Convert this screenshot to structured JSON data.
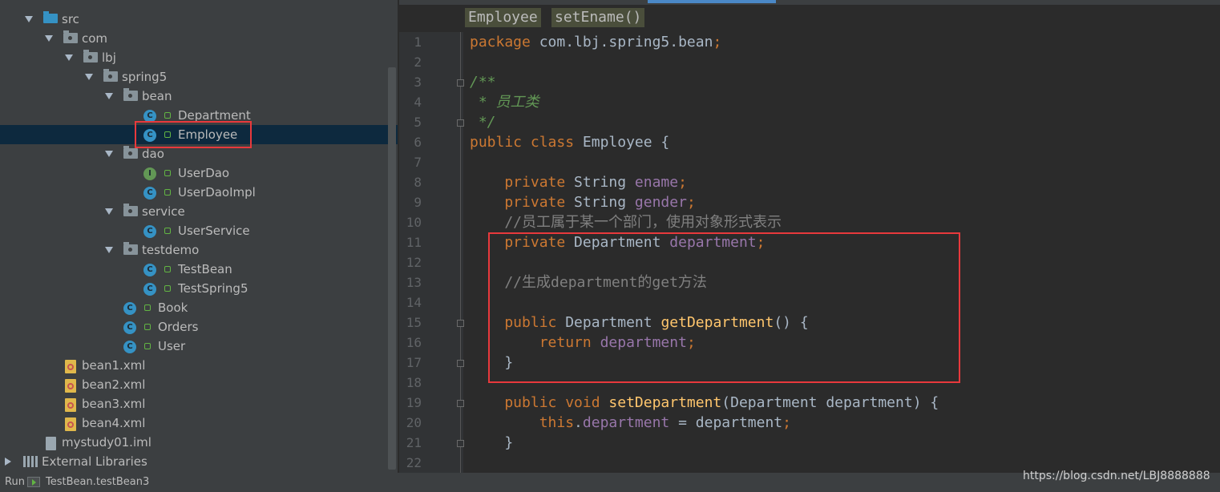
{
  "project_tree": {
    "items": [
      {
        "label": "src",
        "icon": "source-folder-icon"
      },
      {
        "label": "com",
        "icon": "package-icon"
      },
      {
        "label": "lbj",
        "icon": "package-icon"
      },
      {
        "label": "spring5",
        "icon": "package-icon"
      },
      {
        "label": "bean",
        "icon": "package-icon"
      },
      {
        "label": "Department",
        "icon": "class-icon"
      },
      {
        "label": "Employee",
        "icon": "class-icon"
      },
      {
        "label": "dao",
        "icon": "package-icon"
      },
      {
        "label": "UserDao",
        "icon": "interface-icon"
      },
      {
        "label": "UserDaoImpl",
        "icon": "class-icon"
      },
      {
        "label": "service",
        "icon": "package-icon"
      },
      {
        "label": "UserService",
        "icon": "class-icon"
      },
      {
        "label": "testdemo",
        "icon": "package-icon"
      },
      {
        "label": "TestBean",
        "icon": "class-icon"
      },
      {
        "label": "TestSpring5",
        "icon": "class-icon"
      },
      {
        "label": "Book",
        "icon": "class-icon"
      },
      {
        "label": "Orders",
        "icon": "class-icon"
      },
      {
        "label": "User",
        "icon": "class-icon"
      },
      {
        "label": "bean1.xml",
        "icon": "xml-file-icon"
      },
      {
        "label": "bean2.xml",
        "icon": "xml-file-icon"
      },
      {
        "label": "bean3.xml",
        "icon": "xml-file-icon"
      },
      {
        "label": "bean4.xml",
        "icon": "xml-file-icon"
      },
      {
        "label": "mystudy01.iml",
        "icon": "module-file-icon"
      },
      {
        "label": "External Libraries",
        "icon": "libraries-icon"
      }
    ],
    "selected": "Employee"
  },
  "editor": {
    "breadcrumbs": [
      "Employee",
      "setEname()"
    ],
    "lines": [
      {
        "n": "1",
        "p": [
          [
            "k",
            "package "
          ],
          [
            "t",
            "com.lbj.spring5.bean"
          ],
          [
            "k",
            ";"
          ]
        ]
      },
      {
        "n": "2",
        "p": []
      },
      {
        "n": "3",
        "p": [
          [
            "dc",
            "/**"
          ]
        ]
      },
      {
        "n": "4",
        "p": [
          [
            "dc",
            " * 员工类"
          ]
        ]
      },
      {
        "n": "5",
        "p": [
          [
            "dc",
            " */"
          ]
        ]
      },
      {
        "n": "6",
        "p": [
          [
            "k",
            "public class "
          ],
          [
            "t",
            "Employee {"
          ]
        ]
      },
      {
        "n": "7",
        "p": []
      },
      {
        "n": "8",
        "p": [
          [
            "k",
            "    private "
          ],
          [
            "t",
            "String "
          ],
          [
            "f",
            "ename"
          ],
          [
            "k",
            ";"
          ]
        ]
      },
      {
        "n": "9",
        "p": [
          [
            "k",
            "    private "
          ],
          [
            "t",
            "String "
          ],
          [
            "f",
            "gender"
          ],
          [
            "k",
            ";"
          ]
        ]
      },
      {
        "n": "10",
        "p": [
          [
            "c",
            "    //员工属于某一个部门，使用对象形式表示"
          ]
        ]
      },
      {
        "n": "11",
        "p": [
          [
            "k",
            "    private "
          ],
          [
            "t",
            "Department "
          ],
          [
            "f",
            "department"
          ],
          [
            "k",
            ";"
          ]
        ]
      },
      {
        "n": "12",
        "p": []
      },
      {
        "n": "13",
        "p": [
          [
            "c",
            "    //生成department的get方法"
          ]
        ]
      },
      {
        "n": "14",
        "p": []
      },
      {
        "n": "15",
        "p": [
          [
            "k",
            "    public "
          ],
          [
            "t",
            "Department "
          ],
          [
            "m",
            "getDepartment"
          ],
          [
            "t",
            "() {"
          ]
        ]
      },
      {
        "n": "16",
        "p": [
          [
            "k",
            "        return "
          ],
          [
            "f",
            "department"
          ],
          [
            "k",
            ";"
          ]
        ]
      },
      {
        "n": "17",
        "p": [
          [
            "t",
            "    }"
          ]
        ]
      },
      {
        "n": "18",
        "p": []
      },
      {
        "n": "19",
        "p": [
          [
            "k",
            "    public void "
          ],
          [
            "m",
            "setDepartment"
          ],
          [
            "t",
            "(Department department) {"
          ]
        ]
      },
      {
        "n": "20",
        "p": [
          [
            "k",
            "        this"
          ],
          [
            "t",
            "."
          ],
          [
            "f",
            "department"
          ],
          [
            "t",
            " = department"
          ],
          [
            "k",
            ";"
          ]
        ]
      },
      {
        "n": "21",
        "p": [
          [
            "t",
            "    }"
          ]
        ]
      },
      {
        "n": "22",
        "p": []
      }
    ]
  },
  "bottom_bar": {
    "run_label": "Run",
    "run_config": "TestBean.testBean3"
  },
  "watermark": "https://blog.csdn.net/LBJ8888888",
  "colors": {
    "highlight_box": "#e8393c",
    "keyword": "#cc7832",
    "field": "#9876aa",
    "method": "#ffc66d",
    "comment": "#808080",
    "doc_comment": "#629755"
  }
}
